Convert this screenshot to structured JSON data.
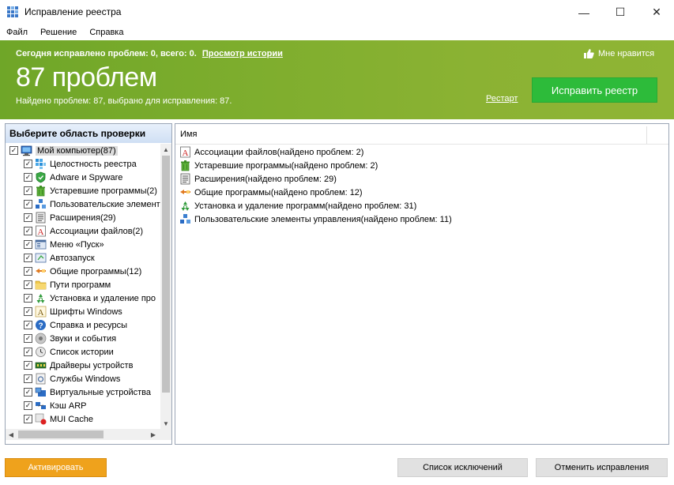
{
  "window": {
    "title": "Исправление реестра",
    "minimize": "—",
    "maximize": "☐",
    "close": "✕"
  },
  "menu": {
    "items": [
      {
        "label": "Файл"
      },
      {
        "label": "Решение"
      },
      {
        "label": "Справка"
      }
    ]
  },
  "banner": {
    "status_text": "Сегодня исправлено проблем: 0, всего: 0.",
    "history_link": "Просмотр истории",
    "like_label": "Мне нравится",
    "problem_count": "87 проблем",
    "found_text": "Найдено проблем: 87, выбрано для исправления: 87.",
    "restart_link": "Рестарт",
    "fix_button": "Исправить реестр"
  },
  "left_panel": {
    "header": "Выберите область проверки",
    "root": {
      "label": "Мой компьютер(87)",
      "checked": true,
      "icon": "computer-icon"
    },
    "items": [
      {
        "label": "Целостность реестра",
        "icon": "registry-icon"
      },
      {
        "label": "Adware и Spyware",
        "icon": "shield-icon"
      },
      {
        "label": "Устаревшие программы(2)",
        "icon": "trash-icon"
      },
      {
        "label": "Пользовательские элемент",
        "icon": "cubes-icon"
      },
      {
        "label": "Расширения(29)",
        "icon": "extension-icon"
      },
      {
        "label": "Ассоциации файлов(2)",
        "icon": "file-assoc-icon"
      },
      {
        "label": "Меню «Пуск»",
        "icon": "start-menu-icon"
      },
      {
        "label": "Автозапуск",
        "icon": "autorun-icon"
      },
      {
        "label": "Общие программы(12)",
        "icon": "shared-programs-icon"
      },
      {
        "label": "Пути программ",
        "icon": "folder-icon"
      },
      {
        "label": "Установка и удаление про",
        "icon": "recycle-icon"
      },
      {
        "label": "Шрифты Windows",
        "icon": "font-icon"
      },
      {
        "label": "Справка и ресурсы",
        "icon": "help-icon"
      },
      {
        "label": "Звуки и события",
        "icon": "sound-icon"
      },
      {
        "label": "Список истории",
        "icon": "history-icon"
      },
      {
        "label": "Драйверы устройств",
        "icon": "driver-icon"
      },
      {
        "label": "Службы Windows",
        "icon": "services-icon"
      },
      {
        "label": "Виртуальные устройства",
        "icon": "virtual-device-icon"
      },
      {
        "label": "Кэш ARP",
        "icon": "arp-cache-icon"
      },
      {
        "label": "MUI Cache",
        "icon": "mui-cache-icon"
      }
    ]
  },
  "right_panel": {
    "column_name": "Имя",
    "results": [
      {
        "label": "Ассоциации файлов(найдено проблем: 2)",
        "icon": "file-assoc-icon"
      },
      {
        "label": "Устаревшие программы(найдено проблем: 2)",
        "icon": "trash-icon"
      },
      {
        "label": "Расширения(найдено проблем: 29)",
        "icon": "extension-icon"
      },
      {
        "label": "Общие программы(найдено проблем: 12)",
        "icon": "shared-programs-icon"
      },
      {
        "label": "Установка и удаление программ(найдено проблем: 31)",
        "icon": "recycle-icon"
      },
      {
        "label": "Пользовательские элементы управления(найдено проблем: 11)",
        "icon": "cubes-icon"
      }
    ]
  },
  "buttons": {
    "activate": "Активировать",
    "exclusions": "Список исключений",
    "undo": "Отменить исправления"
  },
  "colors": {
    "banner_green": "#7fae2e",
    "fix_button_green": "#2dbb3a",
    "activate_orange": "#efa21c"
  }
}
